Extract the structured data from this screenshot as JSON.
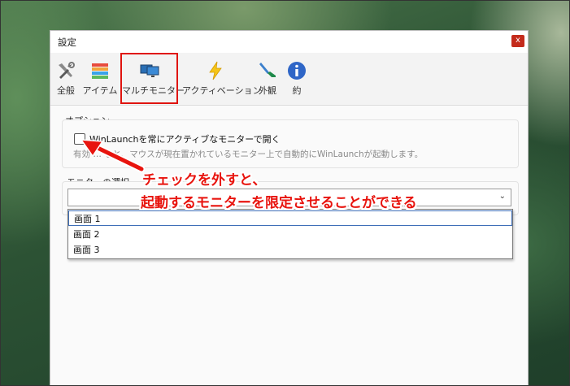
{
  "window": {
    "title": "設定",
    "close_glyph": "x"
  },
  "toolbar": {
    "items": [
      {
        "label": "全般",
        "icon": "tools-icon"
      },
      {
        "label": "アイテム",
        "icon": "stack-icon"
      },
      {
        "label": "マルチモニター",
        "icon": "monitors-icon"
      },
      {
        "label": "アクティベーション",
        "icon": "lightning-icon"
      },
      {
        "label": "外観",
        "icon": "brush-icon"
      },
      {
        "label": "約",
        "icon": "info-icon"
      }
    ],
    "active_index": 2
  },
  "options": {
    "section_label": "オプション",
    "checkbox_label": "WinLaunchを常にアクティブなモニターで開く",
    "checked": false,
    "description": "有効 … ると、マウスが現在置かれているモニター上で自動的にWinLaunchが起動します。"
  },
  "monitor_select": {
    "section_label": "モニターの選択",
    "selected_value": "",
    "options": [
      "画面 1",
      "画面 2",
      "画面 3"
    ],
    "highlighted_index": 0
  },
  "annotation": {
    "line1": "チェックを外すと、",
    "line2": "起動するモニターを限定させることができる",
    "color": "#e8140e"
  },
  "colors": {
    "close_button": "#c42b1c",
    "highlight_box": "#e0140f"
  }
}
